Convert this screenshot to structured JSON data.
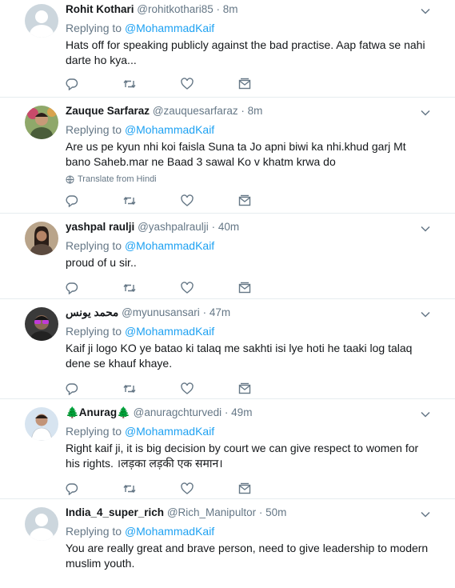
{
  "colors": {
    "accent": "#1da1f2",
    "muted": "#657786",
    "text": "#14171a",
    "divider": "#e6ecf0"
  },
  "icons": {
    "reply": "reply-icon",
    "retweet": "retweet-icon",
    "like": "heart-icon",
    "dm": "envelope-icon",
    "more": "chevron-down-icon",
    "translate": "globe-icon"
  },
  "tweets": [
    {
      "name": "Rohit Kothari",
      "handle": "@rohitkothari85",
      "time": "8m",
      "replying_label": "Replying to",
      "replying_to": "@MohammadKaif",
      "text": "Hats off for speaking publicly against the bad practise. Aap fatwa se nahi darte ho kya..."
    },
    {
      "name": "Zauque Sarfaraz",
      "handle": "@zauquesarfaraz",
      "time": "8m",
      "replying_label": "Replying to",
      "replying_to": "@MohammadKaif",
      "text": "Are us pe kyun nhi koi faisla Suna ta Jo apni biwi ka nhi.khud garj Mt bano Saheb.mar ne Baad 3 sawal Ko v khatm krwa do",
      "translate": "Translate from Hindi"
    },
    {
      "name": "yashpal raulji",
      "handle": "@yashpalraulji",
      "time": "40m",
      "replying_label": "Replying to",
      "replying_to": "@MohammadKaif",
      "text": "proud of u sir.."
    },
    {
      "name": "محمد يونس",
      "handle": "@myunusansari",
      "time": "47m",
      "replying_label": "Replying to",
      "replying_to": "@MohammadKaif",
      "text": "Kaif ji logo KO ye batao ki talaq me sakhti isi lye hoti he taaki log talaq dene se khauf khaye."
    },
    {
      "name": "🌲Anurag🌲",
      "handle": "@anuragchturvedi",
      "time": "49m",
      "replying_label": "Replying to",
      "replying_to": "@MohammadKaif",
      "text": "Right kaif ji, it is big decision by court we can give respect to women for his rights. ।लड़का लड़की एक समान।"
    },
    {
      "name": "India_4_super_rich",
      "handle": "@Rich_Manipultor",
      "time": "50m",
      "replying_label": "Replying to",
      "replying_to": "@MohammadKaif",
      "text": "You are really great and brave person, need to give leadership to modern muslim youth."
    }
  ]
}
